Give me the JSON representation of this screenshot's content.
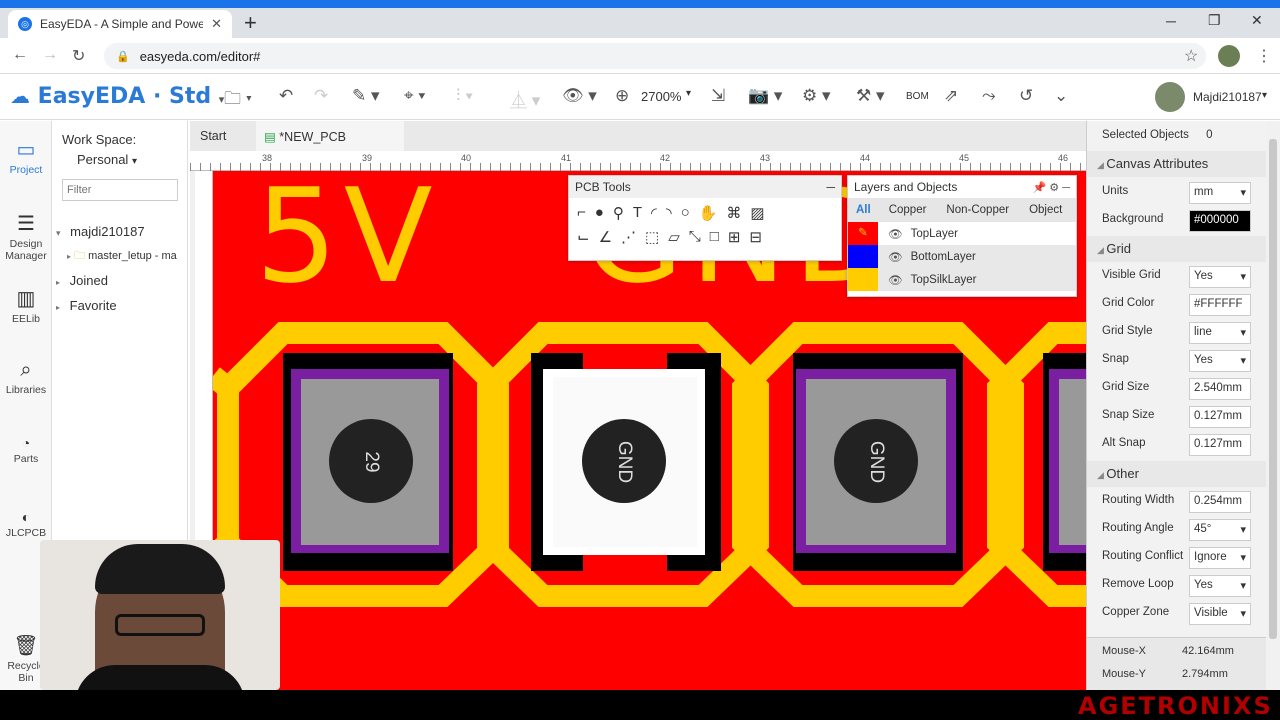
{
  "browser": {
    "tab_title": "EasyEDA - A Simple and Powerfu",
    "tab_close": "✕",
    "new_tab": "+",
    "url": "easyeda.com/editor#",
    "window_controls": [
      "─",
      "❐",
      "✕"
    ]
  },
  "app": {
    "logo": "EasyEDA · Std",
    "zoom": "2700%",
    "bom_label": "BOM",
    "user": "Majdi210187"
  },
  "sidebar": {
    "items": [
      {
        "label": "Project",
        "icon": "folder-icon"
      },
      {
        "label": "Design Manager",
        "icon": "list-icon"
      },
      {
        "label": "EELib",
        "icon": "chip-icon"
      },
      {
        "label": "Libraries",
        "icon": "search-icon"
      },
      {
        "label": "Parts",
        "icon": "lcsc-icon"
      },
      {
        "label": "JLCPCB",
        "icon": "jlc-icon"
      },
      {
        "label": "Recycle Bin",
        "icon": "trash-icon"
      }
    ]
  },
  "workspace": {
    "title": "Work Space:",
    "selected": "Personal",
    "filter_placeholder": "Filter",
    "tree": {
      "user": "majdi210187",
      "folder": "master_letup - ma",
      "joined": "Joined",
      "favorite": "Favorite"
    }
  },
  "doc_tabs": {
    "start": "Start",
    "current": "*NEW_PCB"
  },
  "ruler": {
    "labels": [
      "38",
      "39",
      "40",
      "41",
      "42",
      "43",
      "44",
      "45",
      "46"
    ]
  },
  "board": {
    "silk_5v": "5V",
    "silk_gnd": "GND",
    "pads": [
      "29",
      "GND",
      "GND"
    ]
  },
  "pcb_tools": {
    "title": "PCB Tools",
    "minimize": "─"
  },
  "layers": {
    "title": "Layers and Objects",
    "tabs": [
      "All",
      "Copper",
      "Non-Copper",
      "Object"
    ],
    "rows": [
      {
        "name": "TopLayer",
        "color": "#ff0000"
      },
      {
        "name": "BottomLayer",
        "color": "#0000ff"
      },
      {
        "name": "TopSilkLayer",
        "color": "#ffcc00"
      }
    ]
  },
  "right_panel": {
    "selected_label": "Selected Objects",
    "selected_count": "0",
    "canvas_title": "Canvas Attributes",
    "units_label": "Units",
    "units": "mm",
    "background_label": "Background",
    "background": "#000000",
    "grid_title": "Grid",
    "visible_grid_label": "Visible Grid",
    "visible_grid": "Yes",
    "grid_color_label": "Grid Color",
    "grid_color": "#FFFFFF",
    "grid_style_label": "Grid Style",
    "grid_style": "line",
    "snap_label": "Snap",
    "snap": "Yes",
    "grid_size_label": "Grid Size",
    "grid_size": "2.540mm",
    "snap_size_label": "Snap Size",
    "snap_size": "0.127mm",
    "alt_snap_label": "Alt Snap",
    "alt_snap": "0.127mm",
    "other_title": "Other",
    "routing_width_label": "Routing Width",
    "routing_width": "0.254mm",
    "routing_angle_label": "Routing Angle",
    "routing_angle": "45°",
    "routing_conflict_label": "Routing Conflict",
    "routing_conflict": "Ignore",
    "remove_loop_label": "Remove Loop",
    "remove_loop": "Yes",
    "copper_zone_label": "Copper Zone",
    "copper_zone": "Visible",
    "mouse_x_label": "Mouse-X",
    "mouse_x": "42.164mm",
    "mouse_y_label": "Mouse-Y",
    "mouse_y": "2.794mm"
  },
  "watermark": "AGETRONIXS"
}
